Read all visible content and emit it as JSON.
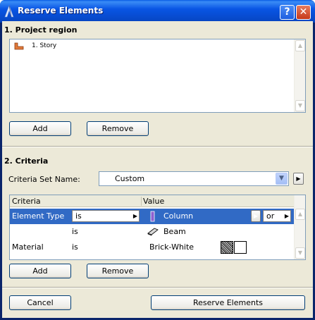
{
  "window": {
    "title": "Reserve Elements",
    "help_label": "?",
    "close_label": "✕"
  },
  "project_region": {
    "title": "1. Project region",
    "items": [
      {
        "label": "1. Story",
        "icon": "story-icon"
      }
    ],
    "add_label": "Add",
    "remove_label": "Remove"
  },
  "criteria": {
    "title": "2. Criteria",
    "set_name_label": "Criteria Set Name:",
    "set_name_value": "Custom",
    "table": {
      "headers": [
        "Criteria",
        "Value"
      ],
      "rows": [
        {
          "criteria": "Element Type",
          "operator": "is",
          "value": "Column",
          "icon": "column-icon",
          "conjunction": "or",
          "selected": true
        },
        {
          "criteria": "",
          "operator": "is",
          "value": "Beam",
          "icon": "beam-icon",
          "selected": false
        },
        {
          "criteria": "Material",
          "operator": "is",
          "value": "Brick-White",
          "icon": "material-hatch-icon",
          "selected": false
        }
      ]
    },
    "add_label": "Add",
    "remove_label": "Remove"
  },
  "footer": {
    "cancel_label": "Cancel",
    "reserve_label": "Reserve Elements"
  },
  "colors": {
    "titlebar": "#0955e4",
    "selection": "#316ac5",
    "dialog_bg": "#ece9d8",
    "story_icon": "#e07a3a"
  }
}
